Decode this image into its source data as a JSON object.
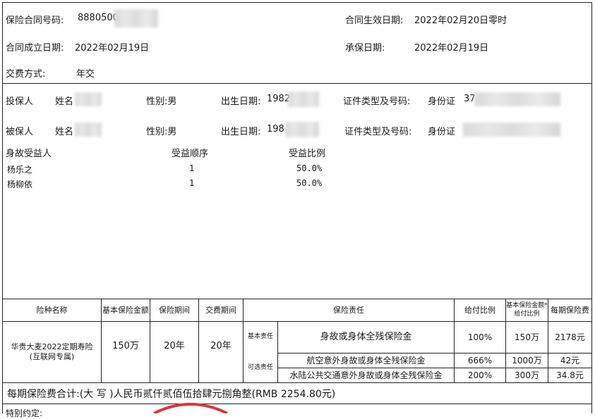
{
  "contract": {
    "number_label": "保险合同号码:",
    "number_value": "8880500",
    "effective_label": "合同生效日期:",
    "effective_value": "2022年02月20日零时",
    "established_label": "合同成立日期:",
    "established_value": "2022年02月19日",
    "underwrite_label": "承保日期:",
    "underwrite_value": "2022年02月19日",
    "payment_label": "交费方式:",
    "payment_value": "年交"
  },
  "policyholder": {
    "role": "投保人",
    "name_label": "姓名",
    "gender": "性别:男",
    "birth_label": "出生日期:",
    "birth_value": "1982",
    "id_label": "证件类型及号码:",
    "id_type": "身份证",
    "id_value": "37"
  },
  "insured": {
    "role": "被保人",
    "name_label": "姓名",
    "gender": "性别:男",
    "birth_label": "出生日期:",
    "birth_value": "198",
    "id_label": "证件类型及号码:",
    "id_type": "身份证"
  },
  "beneficiaries": {
    "headers": [
      "身故受益人",
      "受益顺序",
      "受益比例"
    ],
    "rows": [
      {
        "name": "杨乐之",
        "order": "1",
        "ratio": "50.0%"
      },
      {
        "name": "杨柳依",
        "order": "1",
        "ratio": "50.0%"
      }
    ]
  },
  "coverage_table": {
    "headers": {
      "product": "险种名称",
      "sum_insured": "基本保险金额",
      "insurance_period": "保险期间",
      "payment_period": "交费期间",
      "liability": "保险责任",
      "payout_ratio": "给付比例",
      "payout_amount": "基本保险金额*给付比例",
      "premium": "每期保险费"
    },
    "product_name": "华贵大麦2022定期寿险(互联网专属)",
    "sum_insured": "150万",
    "insurance_period": "20年",
    "payment_period": "20年",
    "basic_label": "基本责任",
    "optional_label": "可选责任",
    "liabilities": [
      {
        "name": "身故或身体全残保险金",
        "ratio": "100%",
        "amount": "150万",
        "premium": "2178元"
      },
      {
        "name": "航空意外身故或身体全残保险金",
        "ratio": "666%",
        "amount": "1000万",
        "premium": "42元"
      },
      {
        "name": "水陆公共交通意外身故或身体全残保险金",
        "ratio": "200%",
        "amount": "300万",
        "premium": "34.8元"
      }
    ]
  },
  "total": {
    "text": "每期保险费合计:(大 写 )人民币贰仟贰佰伍拾肆元捌角整(RMB 2254.80元)"
  },
  "footer": {
    "partial_text": "特别约定:"
  }
}
